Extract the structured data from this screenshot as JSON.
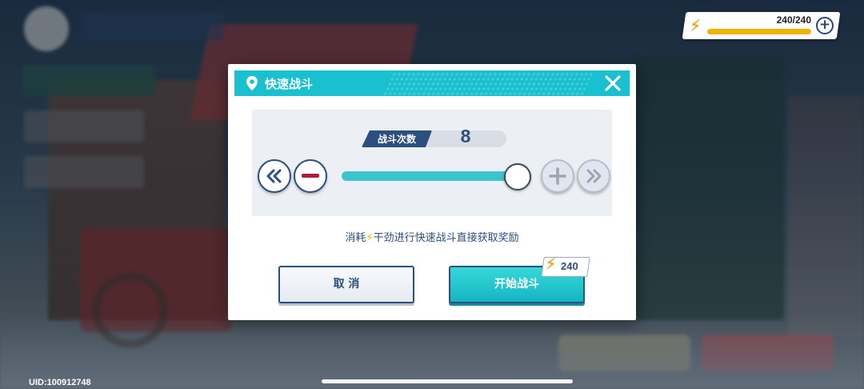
{
  "energy": {
    "current": 240,
    "max": 240,
    "display": "240/240",
    "fill_fraction": 1.0,
    "icon": "lightning-icon",
    "plus_icon": "plus-icon"
  },
  "dialog": {
    "title": "快速战斗",
    "title_icon": "location-pin-icon",
    "close_icon": "close-icon",
    "count_label": "战斗次数",
    "count_value": "8",
    "slider_fraction": 1.0,
    "buttons": {
      "min_icon": "double-chevron-left-icon",
      "minus_icon": "minus-icon",
      "plus_icon": "plus-icon",
      "max_icon": "double-chevron-right-icon"
    },
    "cost_prefix": "消耗",
    "cost_suffix": "干劲进行快速战斗直接获取奖励",
    "cancel_label": "取 消",
    "start_label": "开始战斗",
    "start_cost": "240"
  },
  "footer": {
    "uid": "UID:100912748"
  },
  "colors": {
    "header_teal": "#19c0cf",
    "navy": "#2d4f7f",
    "slider_fill": "#3cc5d0",
    "energy_gold": "#f0b400"
  }
}
